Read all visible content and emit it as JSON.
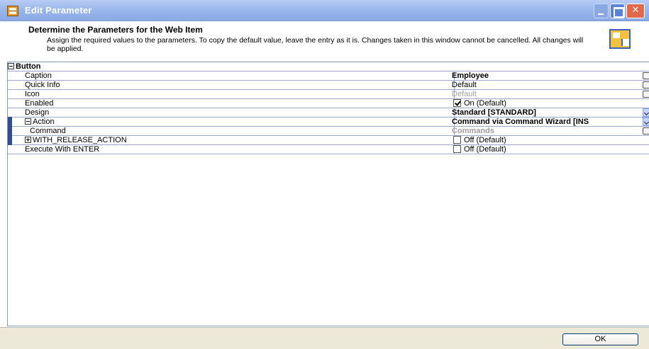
{
  "window": {
    "title": "Edit Parameter"
  },
  "header": {
    "title": "Determine the Parameters for the Web Item",
    "description": "Assign the required values to the parameters. To copy the default value, leave the entry as it is. Changes taken in this window cannot be cancelled. All changes will be applied."
  },
  "grid": {
    "group": "Button",
    "rows": [
      {
        "label": "Caption",
        "value": "Employee"
      },
      {
        "label": "Quick Info",
        "value": "Default"
      },
      {
        "label": "Icon",
        "value": "Default"
      },
      {
        "label": "Enabled",
        "value": "On (Default)"
      },
      {
        "label": "Design",
        "value": "Standard [STANDARD]"
      },
      {
        "label": "Action",
        "value": "Command via Command Wizard [INS"
      },
      {
        "label": "Command",
        "value": "Commands"
      },
      {
        "label": "WITH_RELEASE_ACTION",
        "value": "Off (Default)"
      },
      {
        "label": "Execute With ENTER",
        "value": "Off (Default)"
      }
    ]
  },
  "footer": {
    "ok_label": "OK"
  },
  "colors": {
    "titlebar": "#9cb8ec",
    "close": "#e2694a",
    "footer": "#ece9d8"
  }
}
